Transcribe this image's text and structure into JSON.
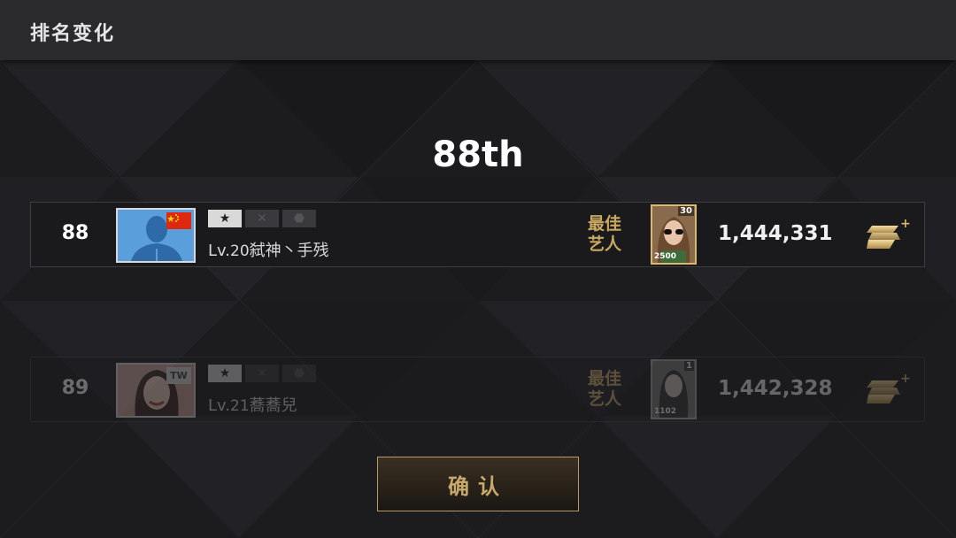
{
  "header": {
    "title": "排名变化"
  },
  "rank_heading": "88th",
  "rows": [
    {
      "rank": "88",
      "flag": "CN",
      "lv_prefix": "Lv.",
      "level": "20",
      "name": "弑神丶手残",
      "best_artist_label": "最佳 艺人",
      "card_level": "30",
      "card_power": "2500",
      "score": "1,444,331"
    },
    {
      "rank": "89",
      "flag": "TW",
      "lv_prefix": "Lv.",
      "level": "21",
      "name": "蕎蕎兒",
      "best_artist_label": "最佳 艺人",
      "card_level": "1",
      "card_power": "1102",
      "score": "1,442,328"
    }
  ],
  "confirm_button": {
    "label": "确认"
  },
  "colors": {
    "gold": "#c9a961",
    "background": "#1c1c1f",
    "header_bar": "#2a2a2d"
  },
  "icons": [
    "star-badge-icon",
    "rank-badge-icon",
    "s-plus-currency-icon",
    "china-flag-icon"
  ]
}
